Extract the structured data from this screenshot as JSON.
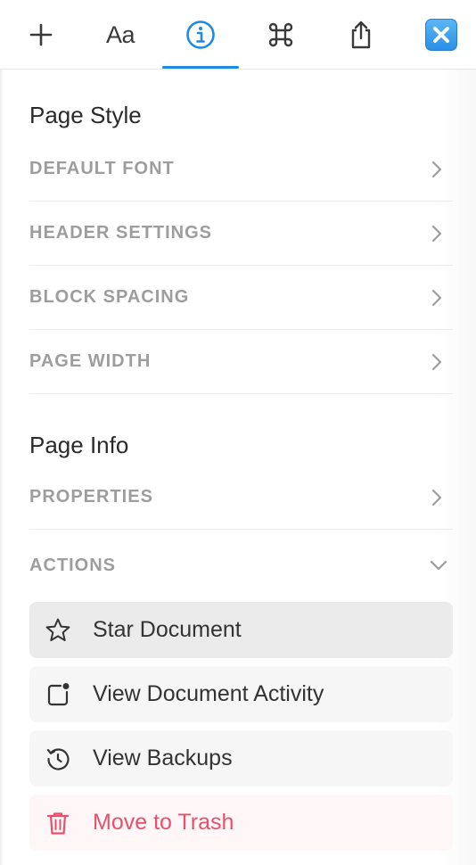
{
  "toolbar": {
    "text_tool_label": "Aa",
    "active_tab": "info",
    "accent_color": "#1f8be0",
    "icons": [
      "plus-icon",
      "text-format-icon",
      "info-icon",
      "command-icon",
      "share-icon",
      "close-icon"
    ]
  },
  "page_style": {
    "title": "Page Style",
    "items": [
      {
        "label": "DEFAULT FONT"
      },
      {
        "label": "HEADER SETTINGS"
      },
      {
        "label": "BLOCK SPACING"
      },
      {
        "label": "PAGE WIDTH"
      }
    ]
  },
  "page_info": {
    "title": "Page Info",
    "properties_label": "PROPERTIES",
    "actions_label": "ACTIONS",
    "actions": [
      {
        "label": "Star Document",
        "icon": "star-icon"
      },
      {
        "label": "View Document Activity",
        "icon": "activity-icon"
      },
      {
        "label": "View Backups",
        "icon": "backups-icon"
      },
      {
        "label": "Move to Trash",
        "icon": "trash-icon",
        "color": "#e8506e"
      }
    ]
  }
}
